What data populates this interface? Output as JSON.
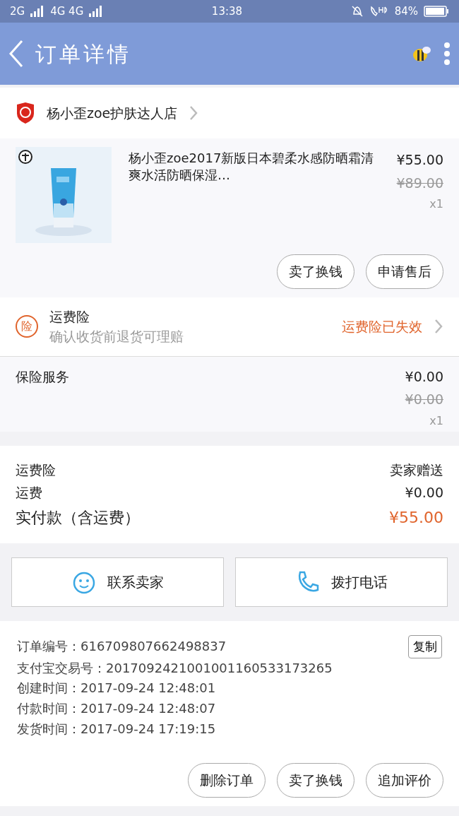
{
  "status_bar": {
    "signal_left": "2G",
    "signal_right": "4G 4G",
    "time": "13:38",
    "battery": "84%"
  },
  "header": {
    "title": "订单详情"
  },
  "shop": {
    "name": "杨小歪zoe护肤达人店"
  },
  "product": {
    "kind": "picture",
    "title": "杨小歪zoe2017新版日本碧柔水感防晒霜清爽水活防晒保湿…",
    "price": "¥55.00",
    "original_price": "¥89.00",
    "quantity": "x1",
    "buttons": [
      "卖了换钱",
      "申请售后"
    ]
  },
  "freight_insurance": {
    "badge": "险",
    "title": "运费险",
    "subtitle": "确认收货前退货可理赔",
    "status": "运费险已失效"
  },
  "insurance_service": {
    "label": "保险服务",
    "price": "¥0.00",
    "original_price": "¥0.00",
    "quantity": "x1"
  },
  "totals": [
    {
      "label": "运费险",
      "value": "卖家赠送",
      "kind": "normal"
    },
    {
      "label": "运费",
      "value": "¥0.00",
      "kind": "normal"
    },
    {
      "label": "实付款（含运费）",
      "value": "¥55.00",
      "kind": "total"
    }
  ],
  "contact": [
    {
      "label": "联系卖家",
      "kind": "chat"
    },
    {
      "label": "拨打电话",
      "kind": "phone"
    }
  ],
  "order_info": {
    "lines": [
      "订单编号：616709807662498837",
      "支付宝交易号：2017092421001001160533173265",
      "创建时间：2017-09-24 12:48:01",
      "付款时间：2017-09-24 12:48:07",
      "发货时间：2017-09-24 17:19:15"
    ],
    "copy_button": "复制"
  },
  "bottom_buttons": [
    "删除订单",
    "卖了换钱",
    "追加评价"
  ]
}
